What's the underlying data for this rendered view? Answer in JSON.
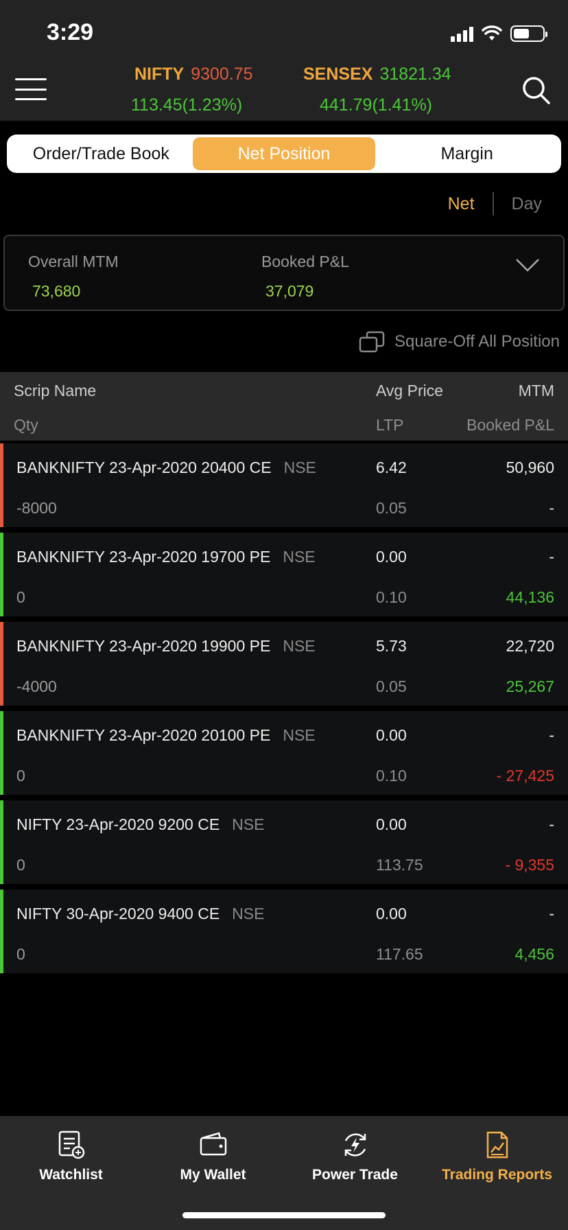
{
  "status": {
    "time": "3:29"
  },
  "indices": [
    {
      "name": "NIFTY",
      "value": "9300.75",
      "change": "113.45(1.23%)"
    },
    {
      "name": "SENSEX",
      "value": "31821.34",
      "change": "441.79(1.41%)"
    }
  ],
  "tabs": [
    "Order/Trade Book",
    "Net Position",
    "Margin"
  ],
  "active_tab": "Net Position",
  "toggle": {
    "net": "Net",
    "day": "Day"
  },
  "summary": {
    "overall_mtm_label": "Overall MTM",
    "overall_mtm_value": "73,680",
    "booked_pl_label": "Booked P&L",
    "booked_pl_value": "37,079"
  },
  "square_off_label": "Square-Off All Position",
  "table": {
    "headers": {
      "scrip": "Scrip Name",
      "avg": "Avg Price",
      "mtm": "MTM",
      "qty": "Qty",
      "ltp": "LTP",
      "booked": "Booked P&L"
    },
    "rows": [
      {
        "name": "BANKNIFTY 23-Apr-2020 20400 CE",
        "exchange": "NSE",
        "qty": "-8000",
        "avg": "6.42",
        "ltp": "0.05",
        "mtm": "50,960",
        "booked": "-"
      },
      {
        "name": "BANKNIFTY 23-Apr-2020 19700 PE",
        "exchange": "NSE",
        "qty": "0",
        "avg": "0.00",
        "ltp": "0.10",
        "mtm": "-",
        "booked": "44,136"
      },
      {
        "name": "BANKNIFTY 23-Apr-2020 19900 PE",
        "exchange": "NSE",
        "qty": "-4000",
        "avg": "5.73",
        "ltp": "0.05",
        "mtm": "22,720",
        "booked": "25,267"
      },
      {
        "name": "BANKNIFTY 23-Apr-2020 20100 PE",
        "exchange": "NSE",
        "qty": "0",
        "avg": "0.00",
        "ltp": "0.10",
        "mtm": "-",
        "booked": "- 27,425"
      },
      {
        "name": "NIFTY 23-Apr-2020 9200 CE",
        "exchange": "NSE",
        "qty": "0",
        "avg": "0.00",
        "ltp": "113.75",
        "mtm": "-",
        "booked": "- 9,355"
      },
      {
        "name": "NIFTY 30-Apr-2020 9400 CE",
        "exchange": "NSE",
        "qty": "0",
        "avg": "0.00",
        "ltp": "117.65",
        "mtm": "-",
        "booked": "4,456"
      }
    ]
  },
  "bottom_nav": [
    {
      "label": "Watchlist",
      "icon": "watchlist-icon"
    },
    {
      "label": "My Wallet",
      "icon": "wallet-icon"
    },
    {
      "label": "Power Trade",
      "icon": "power-trade-icon"
    },
    {
      "label": "Trading Reports",
      "icon": "trading-reports-icon"
    }
  ],
  "colors": {
    "accent": "#f4b04a",
    "positive": "#4cc639",
    "negative": "#e2372c",
    "index_name": "#f0a73e"
  }
}
